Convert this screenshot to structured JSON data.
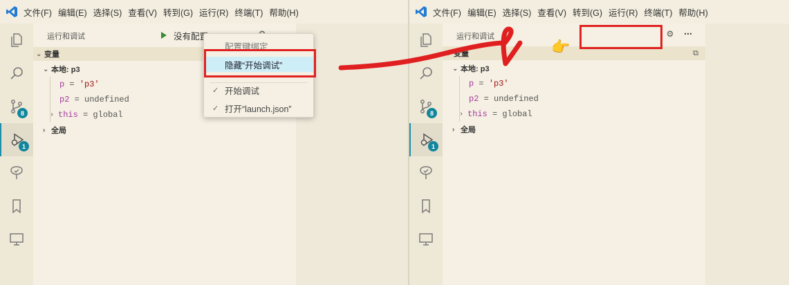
{
  "menu": [
    "文件(F)",
    "编辑(E)",
    "选择(S)",
    "查看(V)",
    "转到(G)",
    "运行(R)",
    "终端(T)",
    "帮助(H)"
  ],
  "colors": {
    "accent": "#1f8ea8",
    "highlight_box": "#e02020",
    "keyword": "#a33b9c",
    "string": "#a31515"
  },
  "activity_bar": {
    "icons": [
      "explorer-icon",
      "search-icon",
      "source-control-icon",
      "run-debug-icon",
      "test-icon",
      "bookmark-icon",
      "remote-explorer-icon"
    ],
    "source_control_badge": "8",
    "debug_badge": "1"
  },
  "left": {
    "sidebar_title": "运行和调试",
    "run_label": "没有配置",
    "variables_section": "变量",
    "local_scope": "本地: p3",
    "vars": [
      {
        "name": "p",
        "eq": "=",
        "value": "'p3'"
      },
      {
        "name": "p2",
        "eq": "=",
        "value": "undefined"
      },
      {
        "name": "this",
        "eq": "=",
        "value": "global"
      }
    ],
    "global_scope": "全局",
    "context_menu": {
      "items": [
        "配置键绑定",
        "隐藏“开始调试”",
        "开始调试",
        "打开“launch.json”"
      ]
    }
  },
  "right": {
    "sidebar_title": "运行和调试",
    "variables_section": "变量",
    "local_scope": "本地: p3",
    "vars": [
      {
        "name": "p",
        "eq": "=",
        "value": "'p3'"
      },
      {
        "name": "p2",
        "eq": "=",
        "value": "undefined"
      },
      {
        "name": "this",
        "eq": "=",
        "value": "global"
      }
    ],
    "global_scope": "全局"
  }
}
